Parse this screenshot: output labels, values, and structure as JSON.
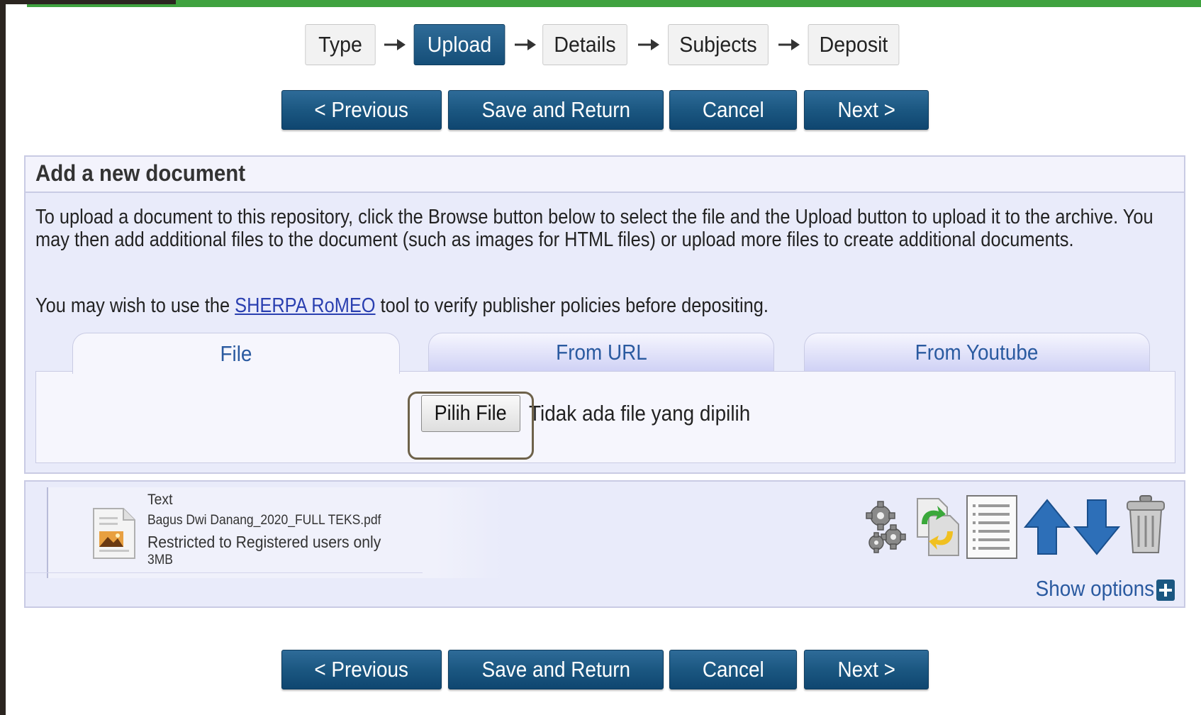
{
  "steps": [
    "Type",
    "Upload",
    "Details",
    "Subjects",
    "Deposit"
  ],
  "active_step": "Upload",
  "buttons": {
    "previous": "< Previous",
    "save_return": "Save and Return",
    "cancel": "Cancel",
    "next": "Next >"
  },
  "panel": {
    "title": "Add a new document",
    "intro": "To upload a document to this repository, click the Browse button below to select the file and the Upload button to upload it to the archive. You may then add additional files to the document (such as images for HTML files) or upload more files to create additional documents.",
    "sherpa_prefix": "You may wish to use the ",
    "sherpa_link": "SHERPA RoMEO",
    "sherpa_suffix": " tool to verify publisher policies before depositing."
  },
  "tabs": [
    {
      "label": "File",
      "active": true
    },
    {
      "label": "From URL",
      "active": false
    },
    {
      "label": "From Youtube",
      "active": false
    }
  ],
  "file_input": {
    "button_label": "Pilih File",
    "status": "Tidak ada file yang dipilih"
  },
  "document": {
    "type": "Text",
    "filename": "Bagus Dwi Danang_2020_FULL TEKS.pdf",
    "access": "Restricted to Registered users only",
    "size": "3MB",
    "icon": "pdf-document-icon",
    "actions": [
      "gears-icon",
      "convert-icon",
      "list-icon",
      "move-up-icon",
      "move-down-icon",
      "trash-icon"
    ]
  },
  "show_options": "Show options",
  "colors": {
    "primary_button": "#1b5781",
    "panel_bg": "#e9ebfa",
    "tab_text": "#2a5aa0",
    "link": "#2a3fb0",
    "top_bar": "#3fa23f"
  }
}
